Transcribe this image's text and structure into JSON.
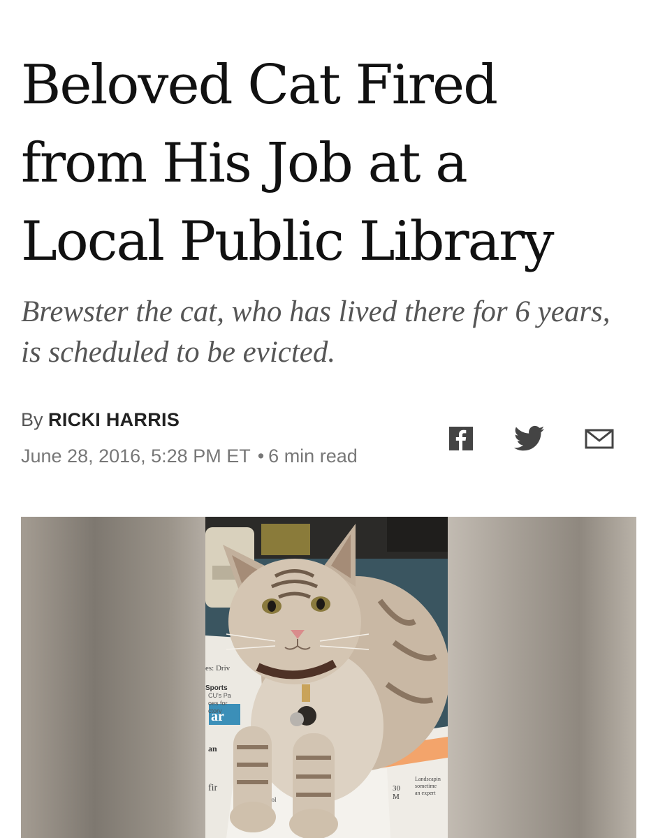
{
  "article": {
    "headline": "Beloved Cat Fired from His Job at a Local Public Library",
    "dek": "Brewster the cat, who has lived there for 6 years, is scheduled to be evicted.",
    "byline_prefix": "By",
    "author": "RICKI HARRIS",
    "date": "June 28, 2016, 5:28 PM ET",
    "separator": "•",
    "read_time": "6 min read"
  },
  "share": {
    "icons": [
      "facebook-icon",
      "twitter-icon",
      "email-icon"
    ]
  },
  "photo": {
    "newspaper_snippets": [
      "es: Driv",
      "Sports",
      "CU's Pa",
      "oes for",
      "ctory",
      "ar",
      "an",
      "fir",
      "school",
      "Landscapin",
      "sometime",
      "an expert",
      "30",
      "M"
    ]
  },
  "colors": {
    "headline": "#111111",
    "dek": "#555555",
    "icons": "#444444"
  }
}
